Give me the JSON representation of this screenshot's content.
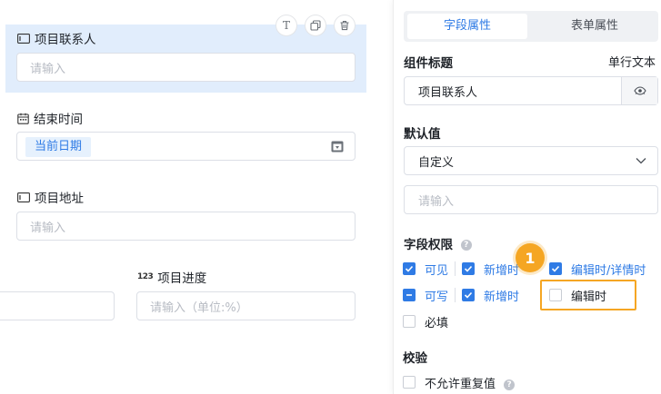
{
  "canvas": {
    "fields": [
      {
        "label": "项目联系人",
        "placeholder": "请输入"
      },
      {
        "label": "结束时间",
        "value": "当前日期"
      },
      {
        "label": "项目地址",
        "placeholder": "请输入"
      },
      {
        "label": "项目进度",
        "placeholder": "请输入（单位:%）"
      }
    ],
    "toolbar": {
      "text_btn": "T"
    }
  },
  "panel": {
    "tabs": [
      "字段属性",
      "表单属性"
    ],
    "component_title": {
      "label": "组件标题",
      "type": "单行文本",
      "value": "项目联系人"
    },
    "default_value": {
      "label": "默认值",
      "select_value": "自定义",
      "placeholder": "请输入"
    },
    "permissions": {
      "label": "字段权限",
      "row1": {
        "visible": "可见",
        "on_add": "新增时",
        "on_edit_detail": "编辑时/详情时"
      },
      "row2": {
        "writable": "可写",
        "on_add": "新增时",
        "on_edit": "编辑时"
      },
      "required": "必填"
    },
    "validation": {
      "label": "校验",
      "no_duplicate": "不允许重复值"
    }
  },
  "annotation": {
    "badge": "1",
    "color": "#f5a623"
  },
  "colors": {
    "accent": "#2f7be5",
    "selected_bg": "#e1edfc"
  }
}
